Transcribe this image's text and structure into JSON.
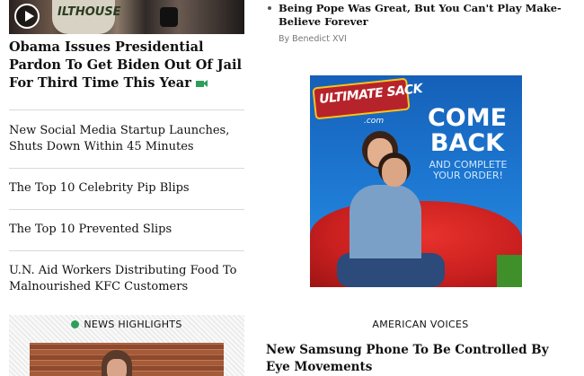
{
  "left": {
    "top_photo": {
      "shirt_text": "ILTHOUSE",
      "icon": "play-icon"
    },
    "lead_headline": "Obama Issues Presidential Pardon To Get Biden Out Of Jail For Third Time This Year",
    "lead_icon": "video-icon",
    "headlines": [
      "New Social Media Startup Launches, Shuts Down Within 45 Minutes",
      "The Top 10 Celebrity Pip Blips",
      "The Top 10 Prevented Slips",
      "U.N. Aid Workers Distributing Food To Malnourished KFC Customers"
    ],
    "news_highlights": {
      "title": "NEWS HIGHLIGHTS",
      "icon": "globe-icon"
    }
  },
  "right": {
    "top_story": {
      "headline": "Being Pope Was Great, But You Can't Play Make-Believe Forever",
      "byline": "By Benedict XVI"
    },
    "ad": {
      "brand": "ULTIMATE SACK",
      "brand_suffix": ".com",
      "headline": "COME BACK",
      "subtext": "AND COMPLETE YOUR ORDER!",
      "colors": {
        "background": "#1e7ad4",
        "accent": "#b7232a",
        "beanbag": "#c81f1f"
      }
    },
    "section_label": "AMERICAN VOICES",
    "section_headline": "New Samsung Phone To Be Controlled By Eye Movements"
  },
  "colors": {
    "accent_green": "#2e9e5b",
    "rule": "#d9d9d9",
    "byline": "#777777"
  }
}
